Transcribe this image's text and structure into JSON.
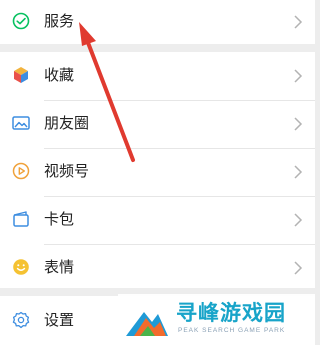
{
  "menu": {
    "services": {
      "label": "服务",
      "icon": "wechat-pay-icon"
    },
    "items": [
      {
        "label": "收藏",
        "icon": "favorites-cube-icon"
      },
      {
        "label": "朋友圈",
        "icon": "moments-photo-icon"
      },
      {
        "label": "视频号",
        "icon": "channels-play-icon"
      },
      {
        "label": "卡包",
        "icon": "card-wallet-icon"
      },
      {
        "label": "表情",
        "icon": "sticker-smile-icon"
      }
    ],
    "settings": {
      "label": "设置",
      "icon": "settings-gear-icon"
    }
  },
  "watermark": {
    "title": "寻峰游戏园",
    "subtitle": "PEAK SEARCH GAME PARK"
  },
  "colors": {
    "background": "#ededed",
    "wechat_green": "#07c160",
    "annotation_arrow": "#e03a2f",
    "watermark_blue": "#18a4c9"
  }
}
